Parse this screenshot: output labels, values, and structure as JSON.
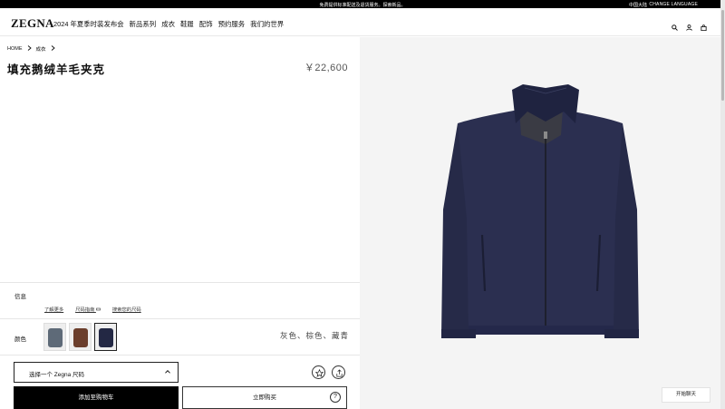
{
  "topbar": {
    "message": "免费提供标准配送及退货服务。探索新品。",
    "region": "中国大陆",
    "language": "CHANGE LANGUAGE"
  },
  "header": {
    "logo": "ZEGNA",
    "nav": [
      "2024 年夏季时装发布会",
      "新品系列",
      "成衣",
      "鞋履",
      "配饰",
      "预约服务",
      "我们的世界"
    ],
    "icons": [
      "search-icon",
      "account-icon",
      "bag-icon"
    ]
  },
  "product": {
    "breadcrumb": [
      "HOME",
      "成衣"
    ],
    "title": "填充鹅绒羊毛夹克",
    "price": "￥22,600",
    "info_label": "信息",
    "info_links": [
      "了解更多",
      "尺码指南",
      "搜索您的尺码"
    ],
    "color_label": "颜色",
    "color_names": "灰色、棕色、藏青",
    "swatch_colors": [
      "#5e6a78",
      "#6b3e2c",
      "#232844"
    ],
    "selected_swatch": 2,
    "size_select_placeholder": "选择一个 Zegna 尺码",
    "add_to_cart": "添加至购物车",
    "buy_now": "立即购买",
    "help_mark": "?"
  },
  "chat_label": "开始聊天"
}
